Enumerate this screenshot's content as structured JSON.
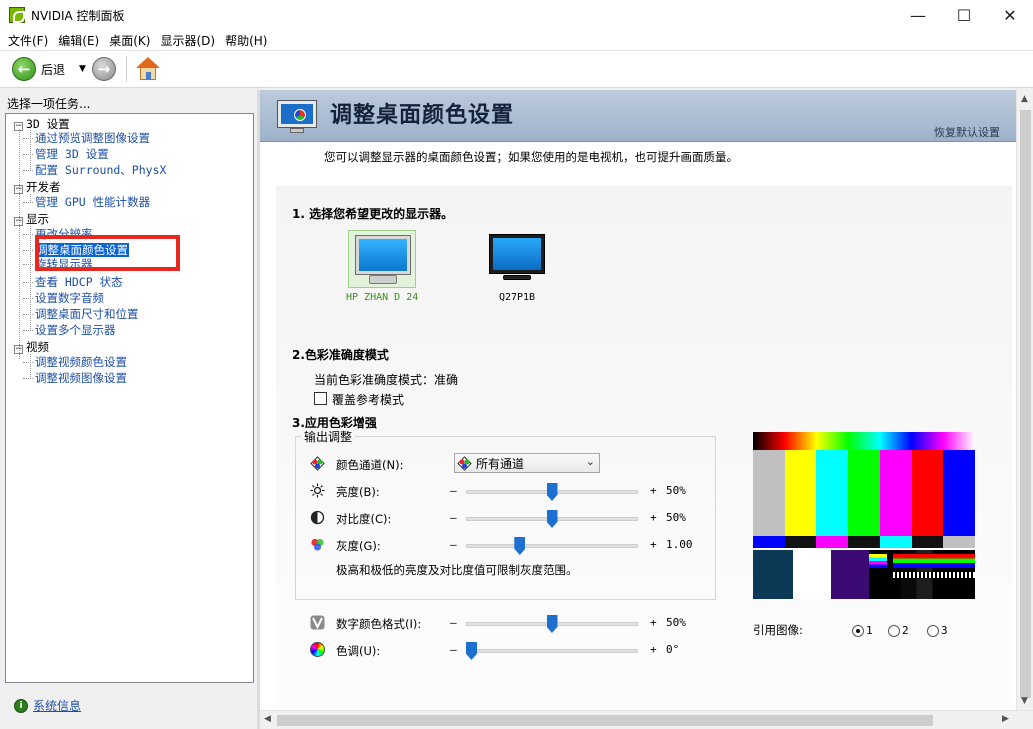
{
  "window": {
    "title": "NVIDIA 控制面板",
    "minimize": "—",
    "maximize": "☐",
    "close": "✕"
  },
  "menu": [
    "文件(F)",
    "编辑(E)",
    "桌面(K)",
    "显示器(D)",
    "帮助(H)"
  ],
  "toolbar": {
    "back_label": "后退"
  },
  "left": {
    "header": "选择一项任务...",
    "tree": [
      {
        "label": "3D 设置",
        "children": [
          "通过预览调整图像设置",
          "管理 3D 设置",
          "配置 Surround、PhysX"
        ]
      },
      {
        "label": "开发者",
        "children": [
          "管理 GPU 性能计数器"
        ]
      },
      {
        "label": "显示",
        "children": [
          "更改分辨率",
          "调整桌面颜色设置",
          "旋转显示器",
          "查看 HDCP 状态",
          "设置数字音频",
          "调整桌面尺寸和位置",
          "设置多个显示器"
        ]
      },
      {
        "label": "视频",
        "children": [
          "调整视频颜色设置",
          "调整视频图像设置"
        ]
      }
    ],
    "selected": "调整桌面颜色设置",
    "system_info": "系统信息"
  },
  "main": {
    "title": "调整桌面颜色设置",
    "restore": "恢复默认设置",
    "description": "您可以调整显示器的桌面颜色设置；如果您使用的是电视机，也可提升画面质量。",
    "section1": "1. 选择您希望更改的显示器。",
    "displays": [
      {
        "name": "HP ZHAN D 24",
        "selected": true
      },
      {
        "name": "Q27P1B",
        "selected": false
      }
    ],
    "section2": "2.色彩准确度模式",
    "accuracy_mode": "当前色彩准确度模式：准确",
    "override_label": "覆盖参考模式",
    "section3": "3.应用色彩增强",
    "group_title": "输出调整",
    "channel_label": "颜色通道(N):",
    "channel_value": "所有通道",
    "sliders": [
      {
        "label": "亮度(B):",
        "value_text": "50%",
        "fraction": 0.5,
        "icon": "sun-icon"
      },
      {
        "label": "对比度(C):",
        "value_text": "50%",
        "fraction": 0.5,
        "icon": "contrast-icon"
      },
      {
        "label": "灰度(G):",
        "value_text": "1.00",
        "fraction": 0.3,
        "icon": "gamma-icon"
      }
    ],
    "gamma_hint": "极高和极低的亮度及对比度值可限制灰度范围。",
    "sliders2": [
      {
        "label": "数字颜色格式(I):",
        "value_text": "50%",
        "fraction": 0.5,
        "icon": "vibrance-icon"
      },
      {
        "label": "色调(U):",
        "value_text": "0°",
        "fraction": 0.0,
        "icon": "hue-icon"
      }
    ],
    "ref_image_label": "引用图像:",
    "ref_options": [
      "1",
      "2",
      "3"
    ],
    "ref_selected": "1",
    "minus_sign": "–",
    "plus_sign": "+"
  },
  "colors": {
    "selection": "#0a64d6",
    "link": "#1d4fa6",
    "highlight_box": "#e8271f",
    "display_selected_text": "#3b8e1e",
    "slider_thumb": "#1d6fd0"
  }
}
